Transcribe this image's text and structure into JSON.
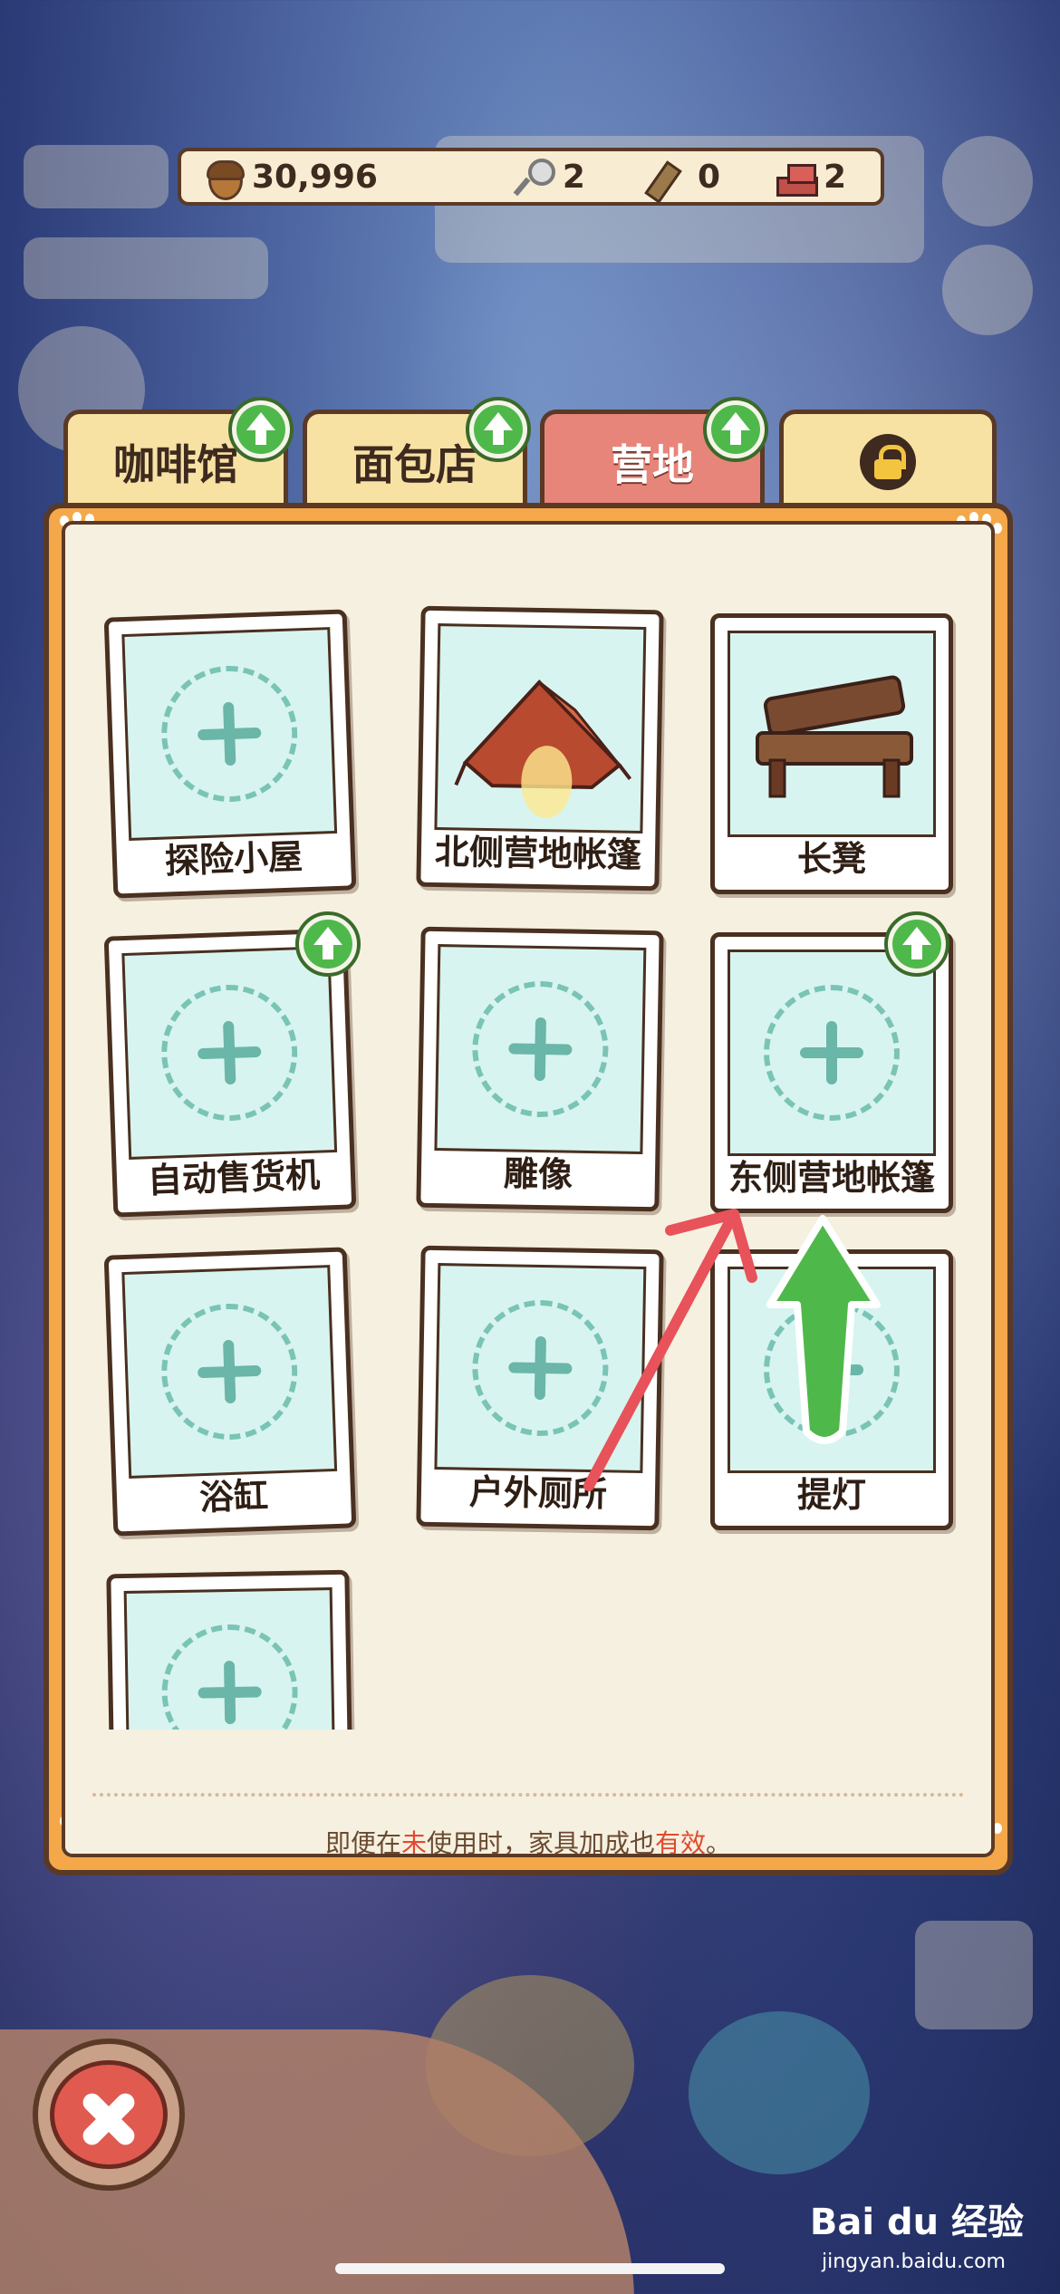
{
  "resources": {
    "acorns": "30,996",
    "keys": "2",
    "planks": "0",
    "bricks": "2"
  },
  "tabs": [
    {
      "label": "咖啡馆",
      "upgrade": true,
      "active": false
    },
    {
      "label": "面包店",
      "upgrade": true,
      "active": false
    },
    {
      "label": "营地",
      "upgrade": true,
      "active": true
    },
    {
      "label": "",
      "locked": true
    }
  ],
  "furniture": [
    {
      "label": "探险小屋",
      "state": "empty"
    },
    {
      "label": "北侧营地帐篷",
      "state": "tent"
    },
    {
      "label": "长凳",
      "state": "bench"
    },
    {
      "label": "自动售货机",
      "state": "empty",
      "upgrade": true
    },
    {
      "label": "雕像",
      "state": "empty"
    },
    {
      "label": "东侧营地帐篷",
      "state": "empty",
      "upgrade": true
    },
    {
      "label": "浴缸",
      "state": "empty"
    },
    {
      "label": "户外厕所",
      "state": "empty"
    },
    {
      "label": "提灯",
      "state": "empty"
    },
    {
      "label": "",
      "state": "empty"
    }
  ],
  "footer": {
    "p1": "即便在",
    "p2": "未",
    "p3": "使用时，家具加成也",
    "p4": "有效",
    "p5": "。"
  },
  "watermark": {
    "brand": "Bai du 经验",
    "url": "jingyan.baidu.com"
  },
  "colors": {
    "panel_orange": "#f5a84a",
    "tab_active": "#e8857a",
    "tab_inactive": "#f7e2a4",
    "photo_bg": "#d8f4f0",
    "accent_red": "#e04a30",
    "upgrade_green": "#4fb84a"
  }
}
